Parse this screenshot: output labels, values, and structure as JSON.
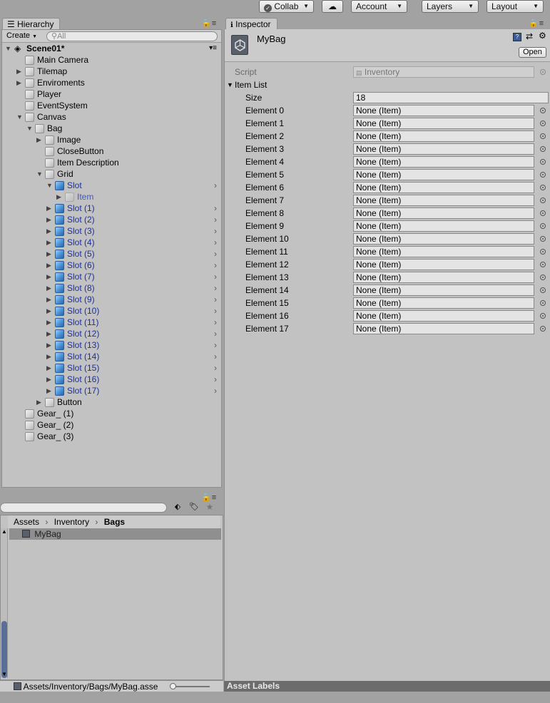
{
  "toolbar": {
    "collab": "Collab",
    "account": "Account",
    "layers": "Layers",
    "layout": "Layout"
  },
  "hierarchy": {
    "tab": "Hierarchy",
    "create": "Create",
    "search_placeholder": "All",
    "scene": "Scene01*",
    "items": [
      {
        "label": "Main Camera",
        "depth": 1,
        "arrow": "",
        "kind": "go"
      },
      {
        "label": "Tilemap",
        "depth": 1,
        "arrow": "right",
        "kind": "go"
      },
      {
        "label": "Enviroments",
        "depth": 1,
        "arrow": "right",
        "kind": "go"
      },
      {
        "label": "Player",
        "depth": 1,
        "arrow": "",
        "kind": "go"
      },
      {
        "label": "EventSystem",
        "depth": 1,
        "arrow": "",
        "kind": "go"
      },
      {
        "label": "Canvas",
        "depth": 1,
        "arrow": "down",
        "kind": "go"
      },
      {
        "label": "Bag",
        "depth": 2,
        "arrow": "down",
        "kind": "go"
      },
      {
        "label": "Image",
        "depth": 3,
        "arrow": "right",
        "kind": "go"
      },
      {
        "label": "CloseButton",
        "depth": 3,
        "arrow": "",
        "kind": "go"
      },
      {
        "label": "Item Description",
        "depth": 3,
        "arrow": "",
        "kind": "go"
      },
      {
        "label": "Grid",
        "depth": 3,
        "arrow": "down",
        "kind": "go"
      },
      {
        "label": "Slot",
        "depth": 4,
        "arrow": "down",
        "kind": "prefab",
        "chevron": true
      },
      {
        "label": "Item",
        "depth": 5,
        "arrow": "right",
        "kind": "faded"
      },
      {
        "label": "Slot (1)",
        "depth": 4,
        "arrow": "right",
        "kind": "prefab",
        "chevron": true
      },
      {
        "label": "Slot (2)",
        "depth": 4,
        "arrow": "right",
        "kind": "prefab",
        "chevron": true
      },
      {
        "label": "Slot (3)",
        "depth": 4,
        "arrow": "right",
        "kind": "prefab",
        "chevron": true
      },
      {
        "label": "Slot (4)",
        "depth": 4,
        "arrow": "right",
        "kind": "prefab",
        "chevron": true
      },
      {
        "label": "Slot (5)",
        "depth": 4,
        "arrow": "right",
        "kind": "prefab",
        "chevron": true
      },
      {
        "label": "Slot (6)",
        "depth": 4,
        "arrow": "right",
        "kind": "prefab",
        "chevron": true
      },
      {
        "label": "Slot (7)",
        "depth": 4,
        "arrow": "right",
        "kind": "prefab",
        "chevron": true
      },
      {
        "label": "Slot (8)",
        "depth": 4,
        "arrow": "right",
        "kind": "prefab",
        "chevron": true
      },
      {
        "label": "Slot (9)",
        "depth": 4,
        "arrow": "right",
        "kind": "prefab",
        "chevron": true
      },
      {
        "label": "Slot (10)",
        "depth": 4,
        "arrow": "right",
        "kind": "prefab",
        "chevron": true
      },
      {
        "label": "Slot (11)",
        "depth": 4,
        "arrow": "right",
        "kind": "prefab",
        "chevron": true
      },
      {
        "label": "Slot (12)",
        "depth": 4,
        "arrow": "right",
        "kind": "prefab",
        "chevron": true
      },
      {
        "label": "Slot (13)",
        "depth": 4,
        "arrow": "right",
        "kind": "prefab",
        "chevron": true
      },
      {
        "label": "Slot (14)",
        "depth": 4,
        "arrow": "right",
        "kind": "prefab",
        "chevron": true
      },
      {
        "label": "Slot (15)",
        "depth": 4,
        "arrow": "right",
        "kind": "prefab",
        "chevron": true
      },
      {
        "label": "Slot (16)",
        "depth": 4,
        "arrow": "right",
        "kind": "prefab",
        "chevron": true
      },
      {
        "label": "Slot (17)",
        "depth": 4,
        "arrow": "right",
        "kind": "prefab",
        "chevron": true
      },
      {
        "label": "Button",
        "depth": 3,
        "arrow": "right",
        "kind": "go"
      },
      {
        "label": "Gear_ (1)",
        "depth": 1,
        "arrow": "",
        "kind": "go"
      },
      {
        "label": "Gear_ (2)",
        "depth": 1,
        "arrow": "",
        "kind": "go"
      },
      {
        "label": "Gear_ (3)",
        "depth": 1,
        "arrow": "",
        "kind": "go"
      }
    ]
  },
  "project": {
    "breadcrumbs": [
      "Assets",
      "Inventory",
      "Bags"
    ],
    "selected_item": "MyBag",
    "footer_path": "Assets/Inventory/Bags/MyBag.asse"
  },
  "inspector": {
    "tab": "Inspector",
    "asset_name": "MyBag",
    "open_button": "Open",
    "script_label": "Script",
    "script_value": "Inventory",
    "list_label": "Item List",
    "size_label": "Size",
    "size_value": "18",
    "elements": [
      {
        "label": "Element 0",
        "value": "None (Item)"
      },
      {
        "label": "Element 1",
        "value": "None (Item)"
      },
      {
        "label": "Element 2",
        "value": "None (Item)"
      },
      {
        "label": "Element 3",
        "value": "None (Item)"
      },
      {
        "label": "Element 4",
        "value": "None (Item)"
      },
      {
        "label": "Element 5",
        "value": "None (Item)"
      },
      {
        "label": "Element 6",
        "value": "None (Item)"
      },
      {
        "label": "Element 7",
        "value": "None (Item)"
      },
      {
        "label": "Element 8",
        "value": "None (Item)"
      },
      {
        "label": "Element 9",
        "value": "None (Item)"
      },
      {
        "label": "Element 10",
        "value": "None (Item)"
      },
      {
        "label": "Element 11",
        "value": "None (Item)"
      },
      {
        "label": "Element 12",
        "value": "None (Item)"
      },
      {
        "label": "Element 13",
        "value": "None (Item)"
      },
      {
        "label": "Element 14",
        "value": "None (Item)"
      },
      {
        "label": "Element 15",
        "value": "None (Item)"
      },
      {
        "label": "Element 16",
        "value": "None (Item)"
      },
      {
        "label": "Element 17",
        "value": "None (Item)"
      }
    ],
    "asset_labels": "Asset Labels"
  },
  "colors": {
    "prefab_text": "#1a2fa0",
    "panel_bg": "#c2c2c2",
    "selection_bg": "#8f8f8f"
  }
}
